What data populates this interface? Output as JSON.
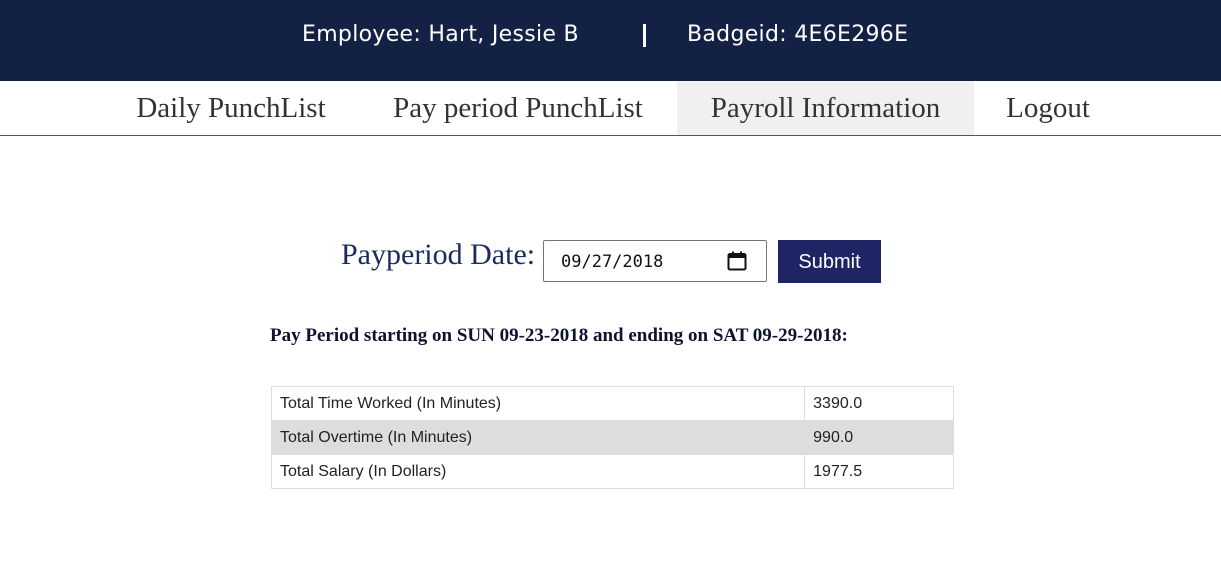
{
  "header": {
    "employee": "Employee: Hart, Jessie B",
    "badge": "Badgeid: 4E6E296E"
  },
  "nav": {
    "items": [
      {
        "label": "Daily PunchList",
        "active": false
      },
      {
        "label": "Pay period PunchList",
        "active": false
      },
      {
        "label": "Payroll Information",
        "active": true
      },
      {
        "label": "Logout",
        "active": false
      }
    ]
  },
  "form": {
    "date_label": "Payperiod Date:",
    "date_value": "09/27/2018",
    "submit_label": "Submit"
  },
  "period_heading": "Pay Period starting on SUN 09-23-2018 and ending on SAT 09-29-2018:",
  "summary": {
    "rows": [
      {
        "label": "Total Time Worked (In Minutes)",
        "value": "3390.0"
      },
      {
        "label": "Total Overtime (In Minutes)",
        "value": "990.0"
      },
      {
        "label": "Total Salary (In Dollars)",
        "value": "1977.5"
      }
    ]
  },
  "colors": {
    "header_bg": "#132244",
    "button_bg": "#1e2565",
    "active_tab_bg": "#f0f0f0"
  },
  "icons": {
    "date_picker": "calendar-icon"
  }
}
